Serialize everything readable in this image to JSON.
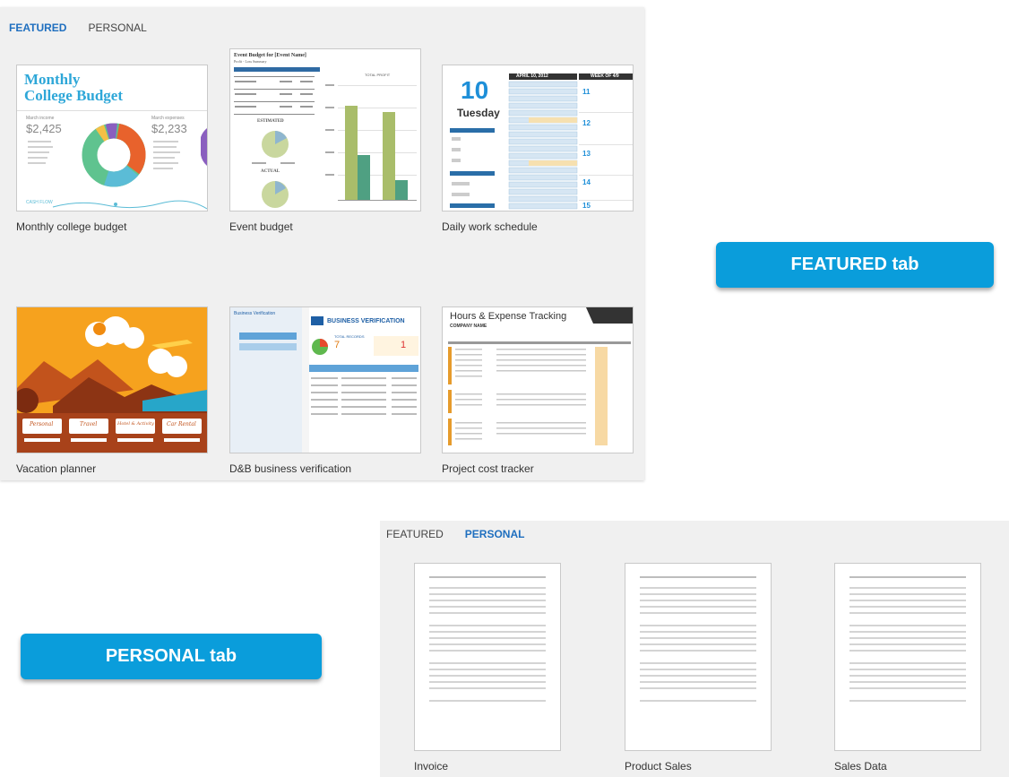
{
  "featured_panel": {
    "tabs": [
      {
        "label": "FEATURED",
        "active": true
      },
      {
        "label": "PERSONAL",
        "active": false
      }
    ],
    "templates": [
      {
        "label": "Monthly college budget",
        "thumb": {
          "title_line1": "Monthly",
          "title_line2": "College Budget",
          "income_label": "March income",
          "income_value": "$2,425",
          "expense_label": "March expenses",
          "expense_value": "$2,233",
          "footer": "CASH FLOW"
        }
      },
      {
        "label": "Event budget",
        "thumb": {
          "title": "Event Budget for [Event Name]",
          "subtitle": "Profit - Loss Summary",
          "estimated": "ESTIMATED",
          "actual": "ACTUAL",
          "chart_title": "TOTAL PROFIT"
        }
      },
      {
        "label": "Daily work schedule",
        "thumb": {
          "day_number": "10",
          "weekday": "Tuesday",
          "date_header": "APRIL 10, 2012",
          "week_header": "WEEK OF 4/9",
          "week_days": [
            "11",
            "12",
            "13",
            "14",
            "15"
          ]
        }
      },
      {
        "label": "Vacation planner",
        "thumb": {
          "buttons": [
            "Personal",
            "Travel",
            "Hotel & Activity",
            "Car Rental"
          ]
        }
      },
      {
        "label": "D&B business verification",
        "thumb": {
          "sidebar_title": "Business Verification",
          "title": "BUSINESS VERIFICATION",
          "total_label": "TOTAL RECORDS",
          "total_value": "7",
          "unmatched_value": "1"
        }
      },
      {
        "label": "Project cost tracker",
        "thumb": {
          "title": "Hours & Expense Tracking",
          "company": "COMPANY NAME"
        }
      }
    ]
  },
  "personal_panel": {
    "tabs": [
      {
        "label": "FEATURED",
        "active": false
      },
      {
        "label": "PERSONAL",
        "active": true
      }
    ],
    "templates": [
      {
        "label": "Invoice"
      },
      {
        "label": "Product Sales"
      },
      {
        "label": "Sales Data"
      }
    ]
  },
  "callouts": {
    "featured": "FEATURED tab",
    "personal": "PERSONAL tab"
  },
  "colors": {
    "accent_blue": "#1f6fbf",
    "callout_blue": "#0a9ddb",
    "panel_bg": "#f0f0f0"
  }
}
